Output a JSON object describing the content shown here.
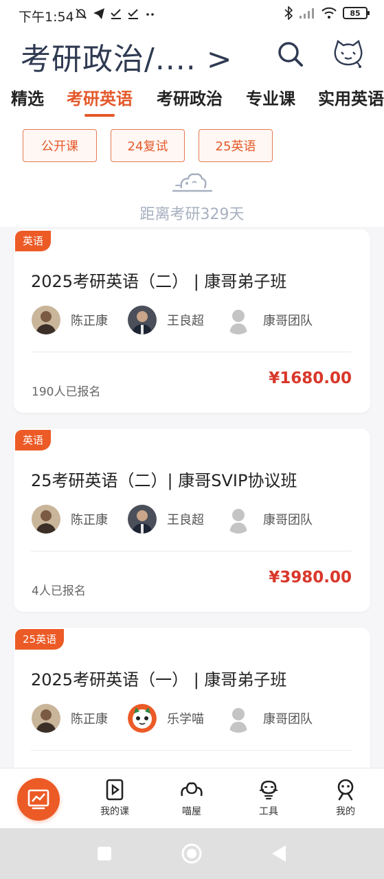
{
  "status_bar": {
    "time": "下午1:54",
    "battery": "85"
  },
  "header": {
    "title": "考研政治/.... >"
  },
  "tabs": [
    {
      "label": "精选"
    },
    {
      "label": "考研英语"
    },
    {
      "label": "考研政治"
    },
    {
      "label": "专业课"
    },
    {
      "label": "实用英语"
    }
  ],
  "chips": [
    {
      "label": "公开课"
    },
    {
      "label": "24复试"
    },
    {
      "label": "25英语"
    }
  ],
  "countdown": "距离考研329天",
  "courses": [
    {
      "tag": "英语",
      "title": "2025考研英语（二） | 康哥弟子班",
      "teachers": [
        {
          "name": "陈正康"
        },
        {
          "name": "王良超"
        },
        {
          "name": "康哥团队"
        }
      ],
      "enrolled": "190人已报名",
      "price": "¥1680.00"
    },
    {
      "tag": "英语",
      "title": "25考研英语（二）| 康哥SVIP协议班",
      "teachers": [
        {
          "name": "陈正康"
        },
        {
          "name": "王良超"
        },
        {
          "name": "康哥团队"
        }
      ],
      "enrolled": "4人已报名",
      "price": "¥3980.00"
    },
    {
      "tag": "25英语",
      "title": "2025考研英语（一） | 康哥弟子班",
      "teachers": [
        {
          "name": "陈正康"
        },
        {
          "name": "乐学喵"
        },
        {
          "name": "康哥团队"
        }
      ],
      "enrolled": "",
      "price": ""
    }
  ],
  "bottom_nav": [
    {
      "label": "我的课",
      "icon": "play-book-icon"
    },
    {
      "label": "喵屋",
      "icon": "cat-ears-icon"
    },
    {
      "label": "工具",
      "icon": "tool-cat-icon"
    },
    {
      "label": "我的",
      "icon": "profile-icon"
    }
  ],
  "colors": {
    "accent": "#ec5a26",
    "price": "#d9372a",
    "title": "#2f3a52"
  }
}
